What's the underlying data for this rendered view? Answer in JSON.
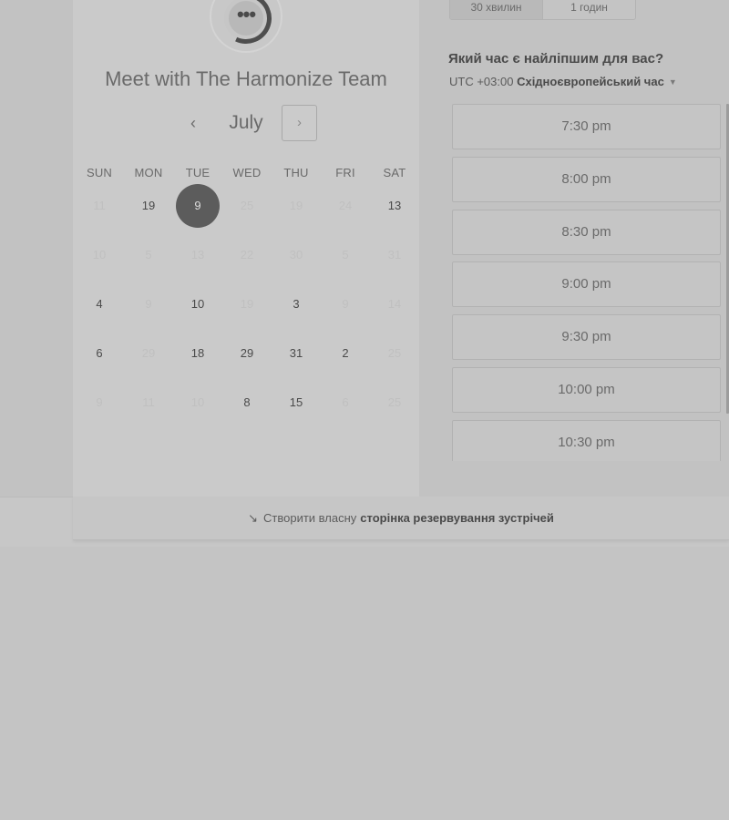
{
  "left": {
    "title": "Meet with The Harmonize Team",
    "month": "July",
    "prev_symbol": "‹",
    "next_symbol": "›",
    "weekdays": [
      "SUN",
      "MON",
      "TUE",
      "WED",
      "THU",
      "FRI",
      "SAT"
    ],
    "weeks": [
      [
        {
          "d": "11",
          "s": "dim"
        },
        {
          "d": "19",
          "s": "on"
        },
        {
          "d": "9",
          "s": "sel"
        },
        {
          "d": "25",
          "s": "dim"
        },
        {
          "d": "19",
          "s": "dim"
        },
        {
          "d": "24",
          "s": "dim"
        },
        {
          "d": "13",
          "s": "on"
        }
      ],
      [
        {
          "d": "10",
          "s": "dim"
        },
        {
          "d": "5",
          "s": "dim"
        },
        {
          "d": "13",
          "s": "dim"
        },
        {
          "d": "22",
          "s": "dim"
        },
        {
          "d": "30",
          "s": "dim"
        },
        {
          "d": "5",
          "s": "dim"
        },
        {
          "d": "31",
          "s": "dim"
        }
      ],
      [
        {
          "d": "4",
          "s": "on"
        },
        {
          "d": "9",
          "s": "dim"
        },
        {
          "d": "10",
          "s": "on"
        },
        {
          "d": "19",
          "s": "dim"
        },
        {
          "d": "3",
          "s": "on"
        },
        {
          "d": "9",
          "s": "dim"
        },
        {
          "d": "14",
          "s": "dim"
        }
      ],
      [
        {
          "d": "6",
          "s": "on"
        },
        {
          "d": "29",
          "s": "dim"
        },
        {
          "d": "18",
          "s": "on"
        },
        {
          "d": "29",
          "s": "on"
        },
        {
          "d": "31",
          "s": "on"
        },
        {
          "d": "2",
          "s": "on"
        },
        {
          "d": "25",
          "s": "dim"
        }
      ],
      [
        {
          "d": "9",
          "s": "dim"
        },
        {
          "d": "11",
          "s": "dim"
        },
        {
          "d": "10",
          "s": "dim"
        },
        {
          "d": "8",
          "s": "on"
        },
        {
          "d": "15",
          "s": "on"
        },
        {
          "d": "6",
          "s": "dim"
        },
        {
          "d": "25",
          "s": "dim"
        }
      ]
    ]
  },
  "right": {
    "durations": [
      {
        "label": "30 хвилин",
        "active": true
      },
      {
        "label": "1 годин",
        "active": false
      }
    ],
    "question": "Який час є найліпшим для вас?",
    "timezone_offset": "UTC +03:00",
    "timezone_name": "Східноєвропейський час",
    "timezone_caret": "▼",
    "slots": [
      "7:30 pm",
      "8:00 pm",
      "8:30 pm",
      "9:00 pm",
      "9:30 pm",
      "10:00 pm",
      "10:30 pm"
    ]
  },
  "footer": {
    "icon": "sprocket-icon",
    "prefix": "Створити власну",
    "link": "сторінка резервування зустрічей"
  }
}
